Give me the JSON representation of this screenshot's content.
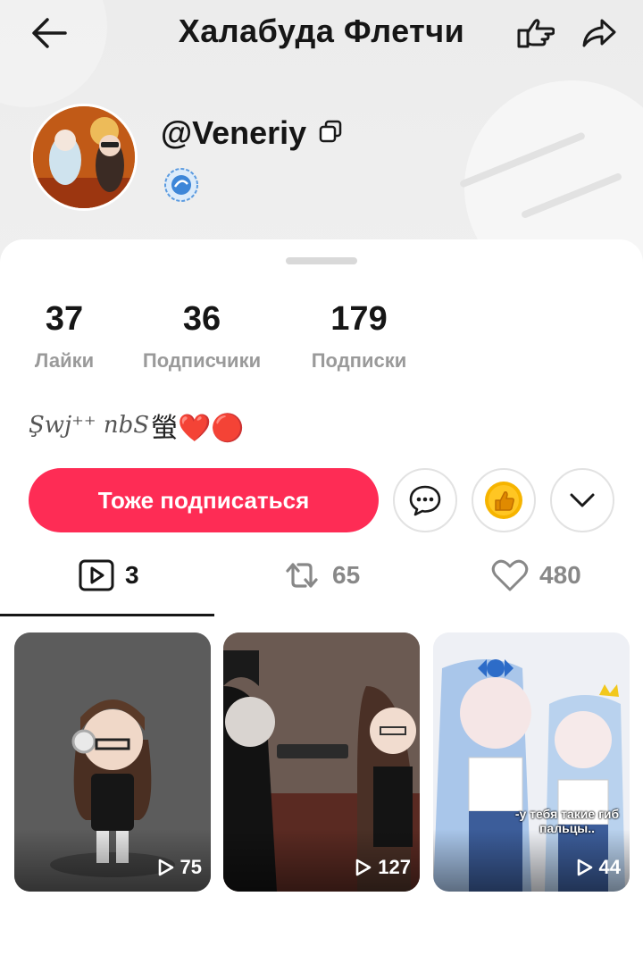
{
  "header": {
    "title": "Халабуда Флетчи",
    "back_icon": "arrow-left-icon",
    "poke_icon": "hand-pointing-icon",
    "share_icon": "share-arrow-icon"
  },
  "profile": {
    "handle": "@Veneriy",
    "copy_icon": "copy-icon",
    "badge_icon": "level-badge-icon"
  },
  "stats": [
    {
      "value": "37",
      "label": "Лайки"
    },
    {
      "value": "36",
      "label": "Подписчики"
    },
    {
      "value": "179",
      "label": "Подписки"
    }
  ],
  "bio": {
    "text": "Şwj⁺⁺ nbS",
    "emoji": "螢❤️🔴"
  },
  "actions": {
    "follow_label": "Тоже подписаться",
    "message_icon": "message-bubble-icon",
    "like_icon": "thumbs-up-coin-icon",
    "more_icon": "chevron-down-icon"
  },
  "tabs": [
    {
      "icon": "play-square-icon",
      "count": "3"
    },
    {
      "icon": "repost-icon",
      "count": "65"
    },
    {
      "icon": "heart-icon",
      "count": "480"
    }
  ],
  "videos": [
    {
      "views": "75"
    },
    {
      "views": "127"
    },
    {
      "views": "44",
      "caption": "-у тебя такие гиб пальцы.."
    }
  ],
  "colors": {
    "accent": "#fe2c55",
    "muted": "#9a9a9a"
  }
}
